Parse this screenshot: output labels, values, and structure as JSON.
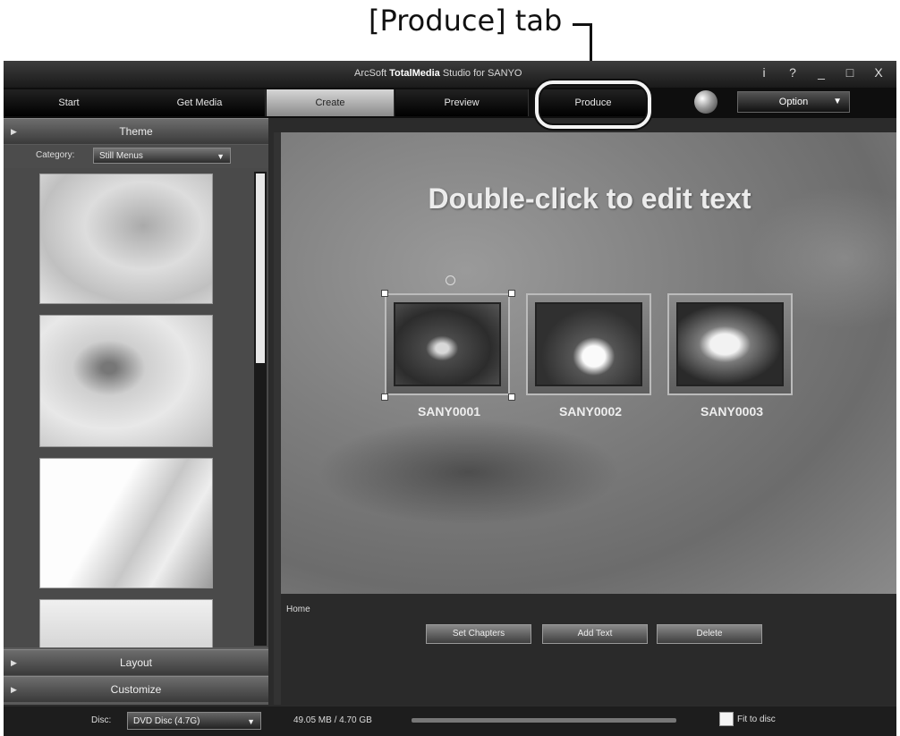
{
  "annotation": {
    "label": "[Produce] tab"
  },
  "window": {
    "title_prefix": "ArcSoft ",
    "title_brand": "TotalMedia",
    "title_suffix": " Studio for SANYO",
    "controls": [
      "i",
      "?",
      "_",
      "□",
      "X"
    ]
  },
  "tabs": [
    {
      "label": "Start",
      "active": false
    },
    {
      "label": "Get Media",
      "active": false
    },
    {
      "label": "Create",
      "active": true
    },
    {
      "label": "Preview",
      "active": false
    },
    {
      "label": "Produce",
      "active": false
    }
  ],
  "option_button": {
    "label": "Option"
  },
  "sidebar": {
    "theme_label": "Theme",
    "category_label": "Category:",
    "category_value": "Still Menus",
    "layout_label": "Layout",
    "customize_label": "Customize"
  },
  "canvas": {
    "headline": "Double-click to edit text",
    "chapters": [
      {
        "label": "SANY0001"
      },
      {
        "label": "SANY0002"
      },
      {
        "label": "SANY0003"
      }
    ]
  },
  "footer": {
    "home_label": "Home",
    "set_chapters": "Set Chapters",
    "add_text": "Add Text",
    "delete": "Delete"
  },
  "status": {
    "disc_label": "Disc:",
    "disc_value": "DVD Disc (4.7G)",
    "size_text": "49.05 MB / 4.70 GB",
    "fit_label": "Fit to disc",
    "fit_checked": false
  }
}
